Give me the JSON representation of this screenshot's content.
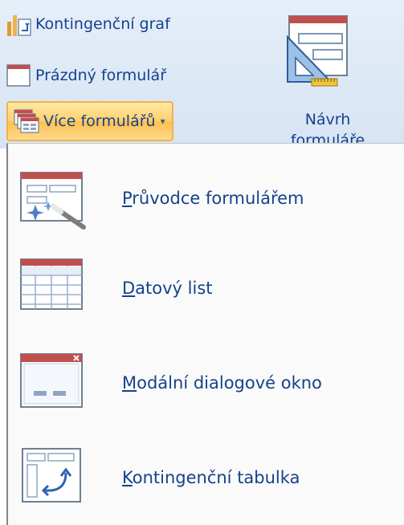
{
  "ribbon": {
    "buttons": {
      "pivot_chart": {
        "label": "Kontingenční graf",
        "icon": "pivot-chart-icon"
      },
      "blank_form": {
        "label": "Prázdný formulář",
        "icon": "blank-form-icon"
      },
      "more_forms": {
        "label": "Více formulářů",
        "icon": "more-forms-icon",
        "arrow": "▾"
      }
    },
    "form_design": {
      "label_line1": "Návrh",
      "label_line2": "formuláře",
      "icon": "form-design-icon"
    }
  },
  "menu": {
    "items": [
      {
        "accel": "P",
        "rest": "růvodce formulářem",
        "icon": "form-wizard-icon"
      },
      {
        "accel": "D",
        "rest": "atový list",
        "icon": "datasheet-icon"
      },
      {
        "accel": "M",
        "rest": "odální dialogové okno",
        "icon": "modal-dialog-icon"
      },
      {
        "accel": "K",
        "rest": "ontingenční tabulka",
        "icon": "pivot-table-icon"
      }
    ]
  },
  "colors": {
    "text": "#15428b",
    "ribbon_bg": "#dfe9f5",
    "highlight": "#ffcf6e",
    "highlight_border": "#f0b247",
    "accent_red": "#c0504d"
  }
}
